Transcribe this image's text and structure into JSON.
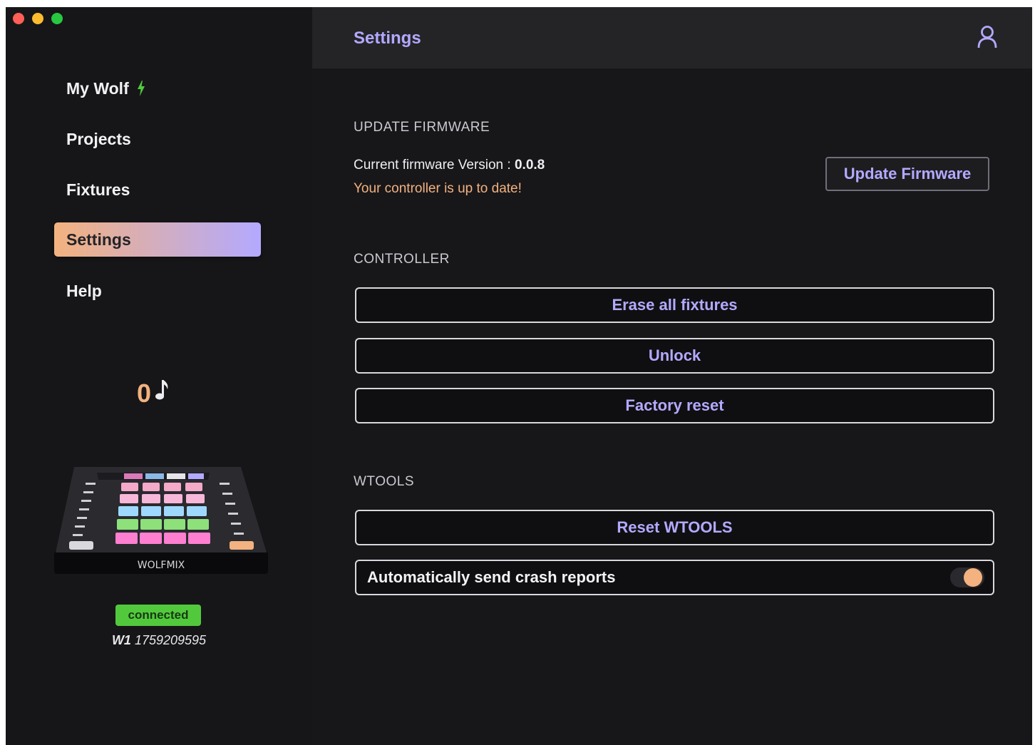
{
  "colors": {
    "accent_purple": "#b3a9ff",
    "accent_orange": "#f3b27f",
    "status_green": "#52c93d",
    "traffic_red": "#ff5f57",
    "traffic_yellow": "#febc2e",
    "traffic_green": "#28c840"
  },
  "sidebar": {
    "items": [
      {
        "label": "My Wolf",
        "icon": "bolt-icon"
      },
      {
        "label": "Projects"
      },
      {
        "label": "Fixtures"
      },
      {
        "label": "Settings",
        "active": true
      },
      {
        "label": "Help"
      }
    ],
    "bpm": {
      "value": "0",
      "icon": "music-note-icon"
    },
    "device": {
      "brand": "WOLFMIX",
      "image": "controller-image"
    },
    "connection": {
      "status": "connected",
      "model": "W1",
      "serial": "1759209595"
    }
  },
  "header": {
    "title": "Settings",
    "user_icon": "user-icon"
  },
  "sections": {
    "firmware": {
      "title": "UPDATE FIRMWARE",
      "version_label": "Current firmware Version : ",
      "version_value": "0.0.8",
      "status": "Your controller is up to date!",
      "button": "Update Firmware"
    },
    "controller": {
      "title": "CONTROLLER",
      "buttons": [
        "Erase all fixtures",
        "Unlock",
        "Factory reset"
      ]
    },
    "wtools": {
      "title": "WTOOLS",
      "reset_button": "Reset WTOOLS",
      "crash_reports_label": "Automatically send crash reports",
      "crash_reports_enabled": true
    }
  }
}
